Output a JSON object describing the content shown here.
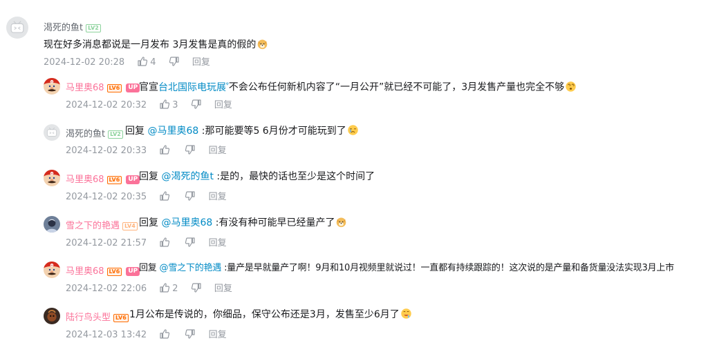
{
  "icons": {
    "like": "thumbs-up-icon",
    "dislike": "thumbs-down-icon",
    "kw_search": "search-superscript-icon"
  },
  "colors": {
    "vip_name": "#fb7299",
    "mention": "#008ac5",
    "meta": "#9499a0"
  },
  "main": {
    "user": "渴死的鱼t",
    "level": "LV2",
    "text": "现在好多消息都说是一月发布 3月发售是真的假的",
    "time": "2024-12-02 20:28",
    "likes": "4",
    "reply_label": "回复"
  },
  "replies": [
    {
      "user": "马里奥68",
      "level": "LV6",
      "up": "UP",
      "text_pre": "官宣",
      "keyword": "台北国际电玩展",
      "text": "不会公布任何新机内容了“一月公开”就已经不可能了，3月发售产量也完全不够",
      "time": "2024-12-02 20:32",
      "likes": "3",
      "reply_label": "回复"
    },
    {
      "user": "渴死的鱼t",
      "level": "LV2",
      "reply_prefix": "回复",
      "mention": "@马里奥68",
      "text": ":那可能要等5 6月份才可能玩到了",
      "time": "2024-12-02 20:33",
      "likes": "",
      "reply_label": "回复"
    },
    {
      "user": "马里奥68",
      "level": "LV6",
      "up": "UP",
      "reply_prefix": "回复",
      "mention": "@渴死的鱼t",
      "text": ":是的，最快的话也至少是这个时间了",
      "time": "2024-12-02 20:35",
      "likes": "",
      "reply_label": "回复"
    },
    {
      "user": "雪之下的艳遇",
      "level": "LV4",
      "reply_prefix": "回复",
      "mention": "@马里奥68",
      "text": ":有没有种可能早已经量产了",
      "time": "2024-12-02 21:57",
      "likes": "",
      "reply_label": "回复"
    },
    {
      "user": "马里奥68",
      "level": "LV6",
      "up": "UP",
      "reply_prefix": "回复",
      "mention": "@雪之下的艳遇",
      "text": ":量产是早就量产了啊！9月和10月视频里就说过！一直都有持续跟踪的！这次说的是产量和备货量没法实现3月上市",
      "time": "2024-12-02 22:06",
      "likes": "2",
      "reply_label": "回复"
    },
    {
      "user": "陆行鸟头型",
      "level": "LV6",
      "text": "1月公布是传说的，你细品，保守公布还是3月，发售至少6月了",
      "time": "2024-12-03 13:42",
      "likes": "",
      "reply_label": "回复"
    }
  ]
}
